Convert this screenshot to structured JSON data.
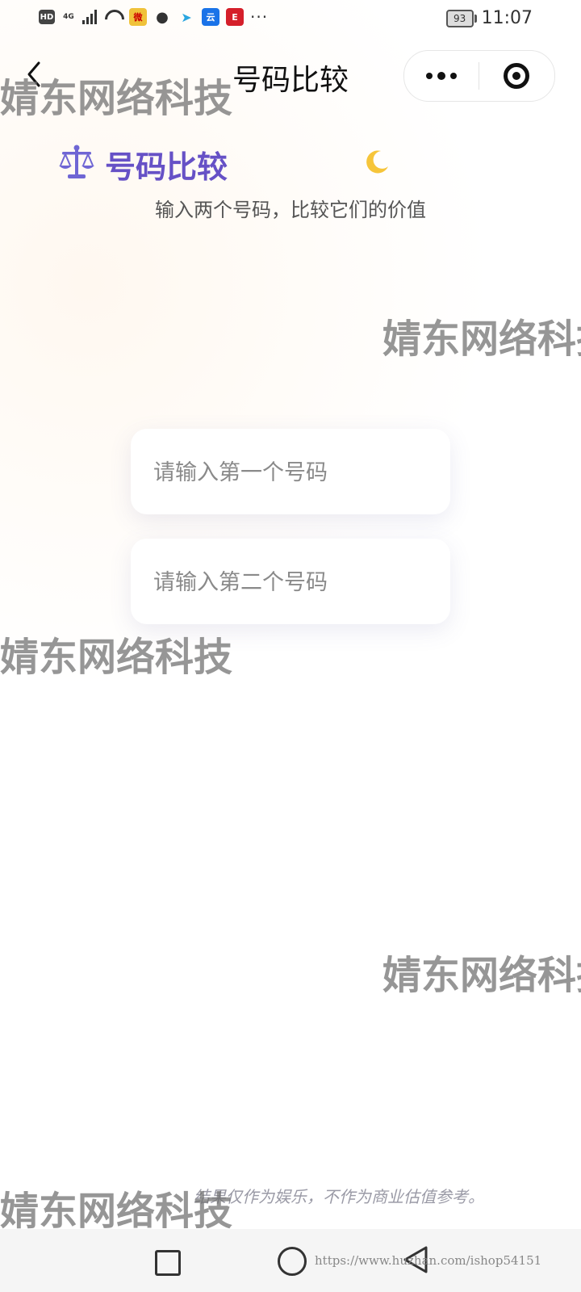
{
  "status_bar": {
    "badges": {
      "hd": "HD",
      "network": "4G",
      "weibo": "微",
      "cloud": "云",
      "red_app": "E",
      "more": "···"
    },
    "battery": "93",
    "time": "11:07"
  },
  "nav": {
    "title": "号码比较"
  },
  "header": {
    "title": "号码比较",
    "subtitle": "输入两个号码，比较它们的价值",
    "accent_color": "#6651c6"
  },
  "inputs": {
    "first_placeholder": "请输入第一个号码",
    "first_value": "",
    "second_placeholder": "请输入第二个号码",
    "second_value": ""
  },
  "disclaimer": "结果仅作为娱乐，不作为商业估值参考。",
  "watermark": "婧东网络科技",
  "footer_url": "https://www.huzhan.com/ishop54151",
  "icons": {
    "back": "back-arrow-icon",
    "more": "more-dots-icon",
    "close": "target-close-icon",
    "scale": "balance-scale-icon",
    "moon": "crescent-moon-icon"
  }
}
